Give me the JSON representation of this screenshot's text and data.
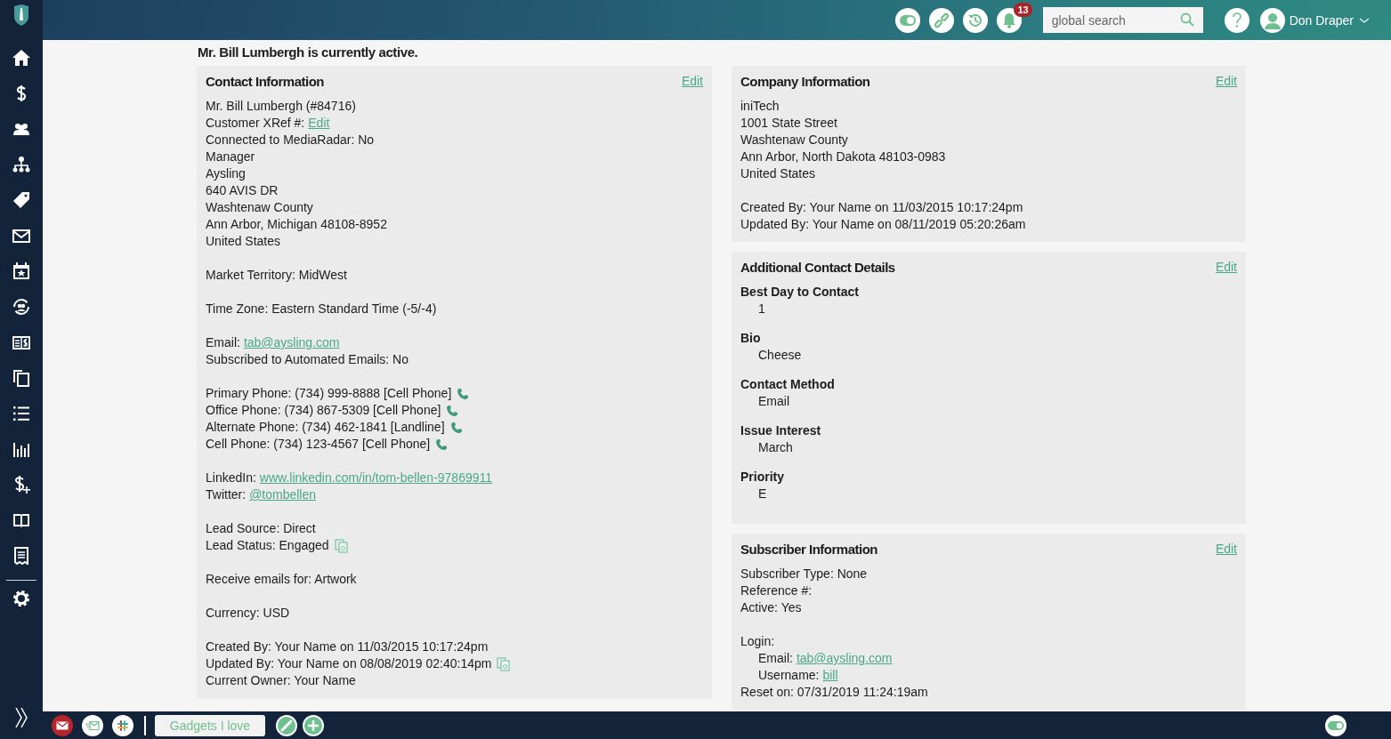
{
  "topbar": {
    "notifications": "13",
    "search": {
      "placeholder": "global search"
    },
    "user": "Don Draper"
  },
  "status_line": "Mr. Bill Lumbergh is currently active.",
  "contact": {
    "title": "Contact Information",
    "edit": "Edit",
    "groups": [
      [
        {
          "text": "Mr. Bill Lumbergh (#84716)"
        },
        {
          "text": "Customer XRef #:",
          "link": "Edit"
        },
        {
          "text": "Connected to MediaRadar: No"
        },
        {
          "text": "Manager"
        },
        {
          "text": "Aysling"
        },
        {
          "text": "640 AVIS DR"
        },
        {
          "text": "Washtenaw County"
        },
        {
          "text": "Ann Arbor, Michigan 48108-8952"
        },
        {
          "text": "United States"
        }
      ],
      [
        {
          "text": "Market Territory: MidWest"
        }
      ],
      [
        {
          "text": "Time Zone: Eastern Standard Time (-5/-4)"
        }
      ],
      [
        {
          "text": "Email:",
          "link": "tab@aysling.com"
        },
        {
          "text": "Subscribed to Automated Emails: No"
        }
      ],
      [
        {
          "text": "Primary Phone: (734) 999-8888 [Cell Phone]",
          "kind": "phone"
        },
        {
          "text": "Office Phone: (734) 867-5309 [Cell Phone]",
          "kind": "phone"
        },
        {
          "text": "Alternate Phone: (734) 462-1841 [Landline]",
          "kind": "phone"
        },
        {
          "text": "Cell Phone: (734) 123-4567 [Cell Phone]",
          "kind": "phone"
        }
      ],
      [
        {
          "text": "LinkedIn:",
          "link": "www.linkedin.com/in/tom-bellen-97869911"
        },
        {
          "text": "Twitter:",
          "link": "@tombellen"
        }
      ],
      [
        {
          "text": "Lead Source: Direct"
        },
        {
          "text": "Lead Status: Engaged",
          "kind": "copy"
        }
      ],
      [
        {
          "text": "Receive emails for: Artwork"
        }
      ],
      [
        {
          "text": "Currency: USD"
        }
      ],
      [
        {
          "text": "Created By: Your Name on 11/03/2015 10:17:24pm"
        },
        {
          "text": "Updated By: Your Name on 08/08/2019 02:40:14pm",
          "kind": "copy"
        },
        {
          "text": "Current Owner: Your Name"
        }
      ]
    ]
  },
  "company": {
    "title": "Company Information",
    "edit": "Edit",
    "groups": [
      [
        {
          "text": "iniTech"
        },
        {
          "text": "1001 State Street"
        },
        {
          "text": "Washtenaw County"
        },
        {
          "text": "Ann Arbor, North Dakota 48103-0983"
        },
        {
          "text": "United States"
        }
      ],
      [
        {
          "text": "Created By: Your Name on 11/03/2015 10:17:24pm"
        },
        {
          "text": "Updated By: Your Name on 08/11/2019 05:20:26am"
        }
      ]
    ]
  },
  "details": {
    "title": "Additional Contact Details",
    "edit": "Edit",
    "fields": [
      {
        "label": "Best Day to Contact",
        "value": "1"
      },
      {
        "label": "Bio",
        "value": "Cheese"
      },
      {
        "label": "Contact Method",
        "value": "Email"
      },
      {
        "label": "Issue Interest",
        "value": "March"
      },
      {
        "label": "Priority",
        "value": "E"
      }
    ]
  },
  "subscriber": {
    "title": "Subscriber Information",
    "edit": "Edit",
    "groups": [
      [
        {
          "text": "Subscriber Type: None"
        },
        {
          "text": "Reference #:"
        },
        {
          "text": "Active: Yes"
        }
      ],
      [
        {
          "text": "Login:",
          "children": [
            {
              "text": "Email:",
              "link": "tab@aysling.com"
            },
            {
              "text": "Username:",
              "link": "bill"
            }
          ]
        },
        {
          "text": "Reset on: 07/31/2019 11:24:19am"
        }
      ]
    ]
  },
  "bottombar": {
    "tab": "Gadgets I love"
  }
}
